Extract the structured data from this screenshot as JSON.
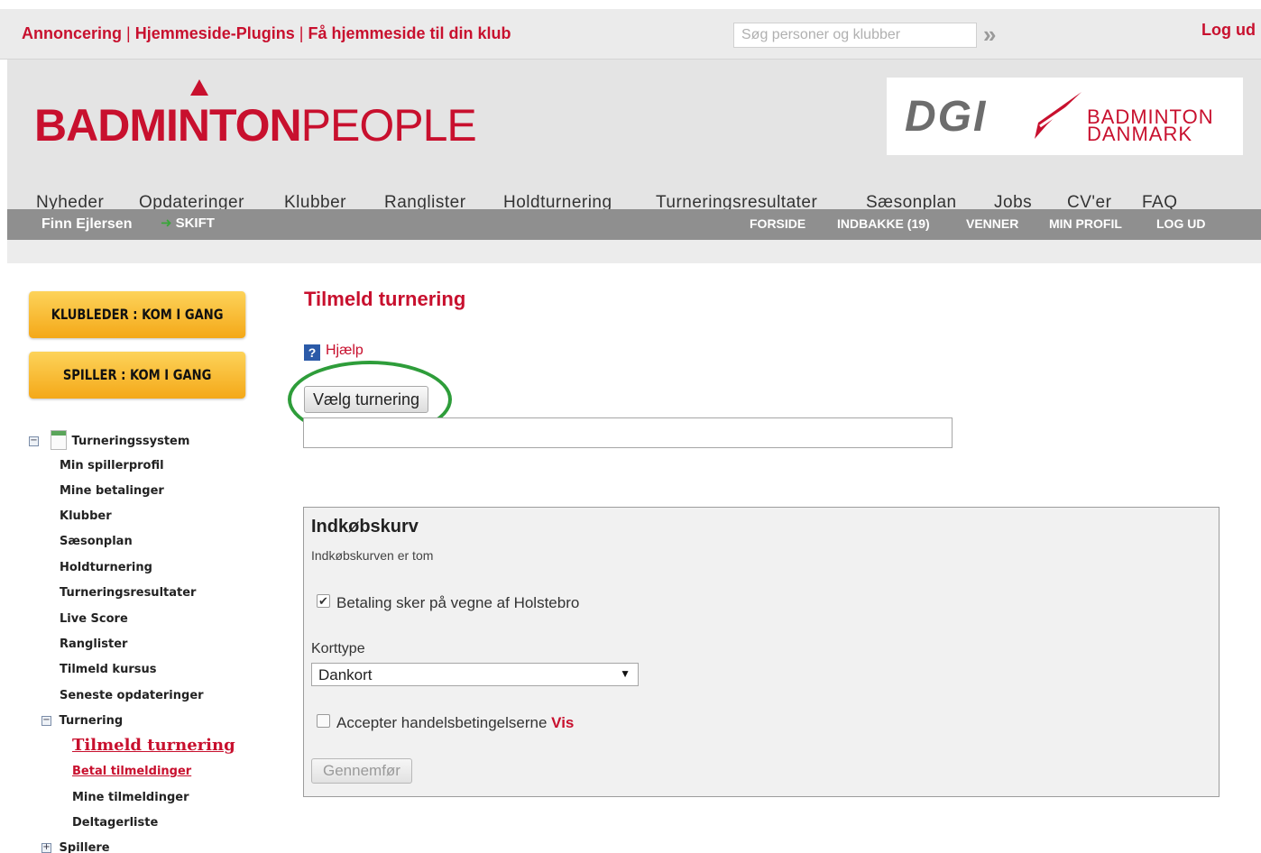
{
  "topbar": {
    "links": [
      "Annoncering",
      "Hjemmeside-Plugins",
      "Få hjemmeside til din klub"
    ],
    "separator": "|",
    "search_placeholder": "Søg personer og klubber",
    "search_go": "»",
    "logout": "Log ud"
  },
  "header": {
    "brand_bold": "BADMINTON",
    "brand_light": "PEOPLE",
    "partner_dgi": "DGI",
    "partner_line1": "BADMINTON",
    "partner_line2": "DANMARK",
    "brand_color": "#c8102e"
  },
  "mainnav": [
    "Nyheder",
    "Opdateringer",
    "Klubber",
    "Ranglister",
    "Holdturnering",
    "Turneringsresultater",
    "Sæsonplan",
    "Jobs",
    "CV'er",
    "FAQ"
  ],
  "userbar": {
    "name": "Finn Ejlersen",
    "skift": "SKIFT",
    "links": [
      "FORSIDE",
      "INDBAKKE (19)",
      "VENNER",
      "MIN PROFIL",
      "LOG UD"
    ]
  },
  "sidebar": {
    "klubleder_btn": "KLUBLEDER : KOM I GANG",
    "spiller_btn": "SPILLER : KOM I GANG",
    "tree_root": "Turneringssystem",
    "items": [
      "Min spillerprofil",
      "Mine betalinger",
      "Klubber",
      "Sæsonplan",
      "Holdturnering",
      "Turneringsresultater",
      "Live Score",
      "Ranglister",
      "Tilmeld kursus",
      "Seneste opdateringer"
    ],
    "turnering": "Turnering",
    "turnering_items": [
      "Tilmeld turnering",
      "Betal tilmeldinger",
      "Mine tilmeldinger",
      "Deltagerliste"
    ],
    "spillere": "Spillere"
  },
  "main": {
    "title": "Tilmeld turnering",
    "help": "Hjælp",
    "choose_button": "Vælg turnering",
    "tournament_value": ""
  },
  "cart": {
    "title": "Indkøbskurv",
    "empty_text": "Indkøbskurven er tom",
    "pay_label": "Betaling sker på vegne af Holstebro",
    "pay_checked": true,
    "card_type_label": "Korttype",
    "card_type_value": "Dankort",
    "accept_label": "Accepter handelsbetingelserne",
    "accept_link": "Vis",
    "accept_checked": false,
    "submit": "Gennemfør"
  }
}
